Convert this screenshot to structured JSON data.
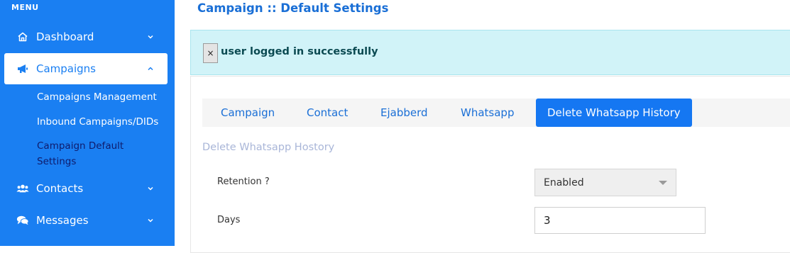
{
  "sidebar": {
    "heading": "MENU",
    "items": [
      {
        "label": "Dashboard",
        "icon": "home-icon",
        "chevron": "down"
      },
      {
        "label": "Campaigns",
        "icon": "megaphone-icon",
        "chevron": "up",
        "active": true
      },
      {
        "label": "Contacts",
        "icon": "users-icon",
        "chevron": "down"
      },
      {
        "label": "Messages",
        "icon": "chat-icon",
        "chevron": "down"
      }
    ],
    "subitems": [
      {
        "label": "Campaigns Management"
      },
      {
        "label": "Inbound Campaigns/DIDs"
      },
      {
        "label": "Campaign Default Settings",
        "current": true
      }
    ]
  },
  "main": {
    "title": "Campaign :: Default Settings",
    "alert": {
      "close": "×",
      "text": "user logged in successfully"
    },
    "tabs": [
      {
        "label": "Campaign"
      },
      {
        "label": "Contact"
      },
      {
        "label": "Ejabberd"
      },
      {
        "label": "Whatsapp"
      },
      {
        "label": "Delete Whatsapp History",
        "active": true
      }
    ],
    "section_title": "Delete Whatsapp Hostory",
    "form": {
      "retention_label": "Retention ?",
      "retention_value": "Enabled",
      "days_label": "Days",
      "days_value": "3"
    }
  },
  "colors": {
    "sidebar_bg": "#1a7ff2",
    "accent": "#1577f2",
    "alert_bg": "#d1f3f8"
  }
}
